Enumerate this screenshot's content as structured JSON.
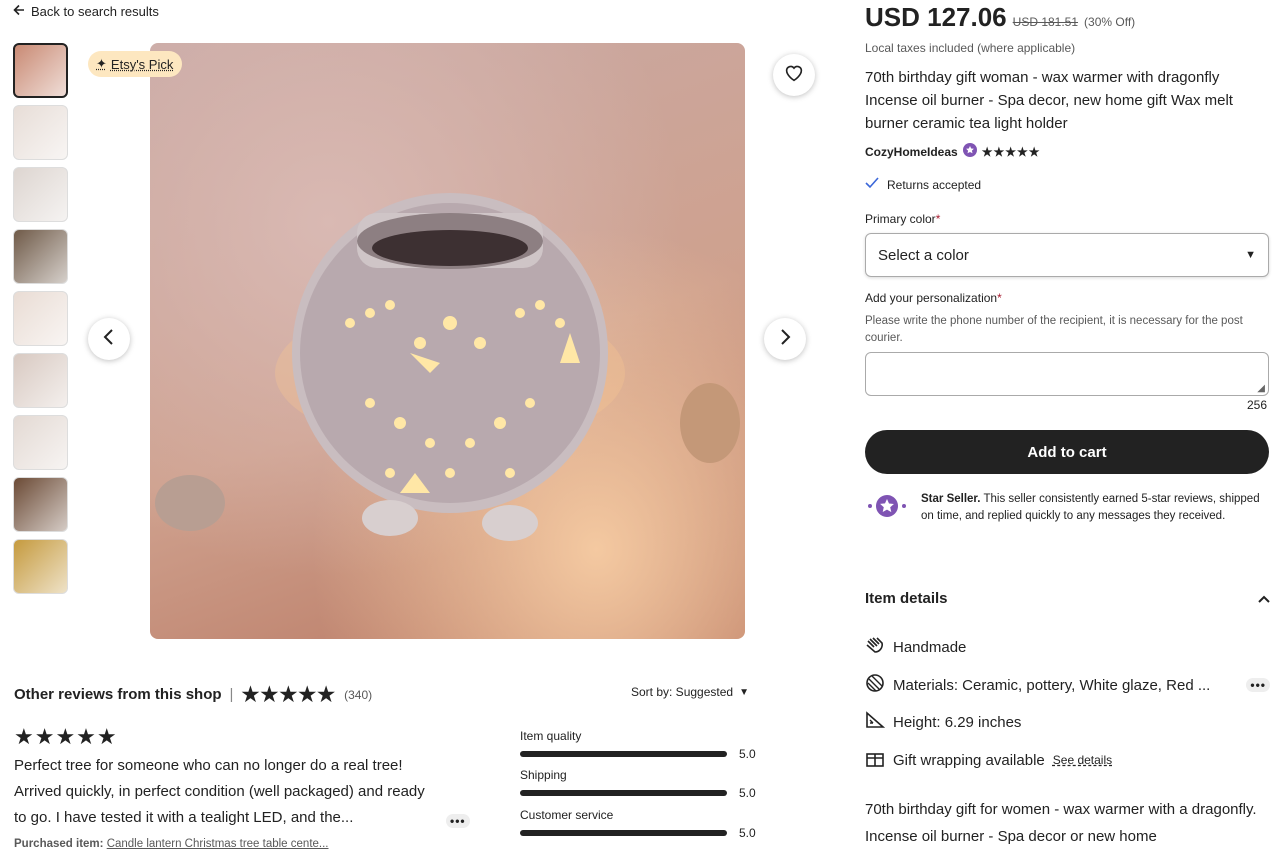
{
  "nav": {
    "back_label": "Back to search results"
  },
  "gallery": {
    "badge_label": "Etsy's Pick",
    "thumb_colors": [
      "#c98a74",
      "#e7ddd7",
      "#ddd5d0",
      "#6f5a48",
      "#e9dcd4",
      "#d8c9c1",
      "#e3d9d3",
      "#6b4a35",
      "#c59a3e"
    ]
  },
  "product": {
    "price": "USD 127.06",
    "original_price": "USD 181.51",
    "discount": "(30% Off)",
    "tax_note": "Local taxes included (where applicable)",
    "title": "70th birthday gift woman - wax warmer with dragonfly Incense oil burner - Spa decor, new home gift Wax melt burner ceramic tea light holder",
    "shop_name": "CozyHomeIdeas",
    "shop_rating": 5,
    "returns": "Returns accepted"
  },
  "form": {
    "color_label": "Primary color",
    "color_value": "Select a color",
    "personalization_label": "Add your personalization",
    "personalization_hint": "Please write the phone number of the recipient, it is necessary for the post courier.",
    "char_count": "256",
    "add_to_cart": "Add to cart"
  },
  "star_seller": {
    "title": "Star Seller.",
    "text": "This seller consistently earned 5-star reviews, shipped on time, and replied quickly to any messages they received."
  },
  "item_details": {
    "heading": "Item details",
    "rows": [
      {
        "icon": "hand-icon",
        "text": "Handmade"
      },
      {
        "icon": "yarn-icon",
        "text": "Materials: Ceramic, pottery, White glaze, Red ..."
      },
      {
        "icon": "ruler-icon",
        "text": "Height: 6.29 inches"
      },
      {
        "icon": "gift-icon",
        "text": "Gift wrapping available",
        "link": "See details"
      }
    ],
    "description": "70th birthday gift for women - wax warmer with a dragonfly. Incense oil burner - Spa decor or new home"
  },
  "reviews": {
    "heading": "Other reviews from this shop",
    "count": "(340)",
    "sort_label": "Sort by: Suggested",
    "review_text": "Perfect tree for someone who can no longer do a real tree! Arrived quickly, in perfect condition (well packaged) and ready to go. I have tested it with a tealight LED, and the...",
    "purchased_label": "Purchased item:",
    "purchased_item": "Candle lantern Christmas tree table cente...",
    "ratings": [
      {
        "label": "Item quality",
        "value": "5.0"
      },
      {
        "label": "Shipping",
        "value": "5.0"
      },
      {
        "label": "Customer service",
        "value": "5.0"
      }
    ]
  }
}
